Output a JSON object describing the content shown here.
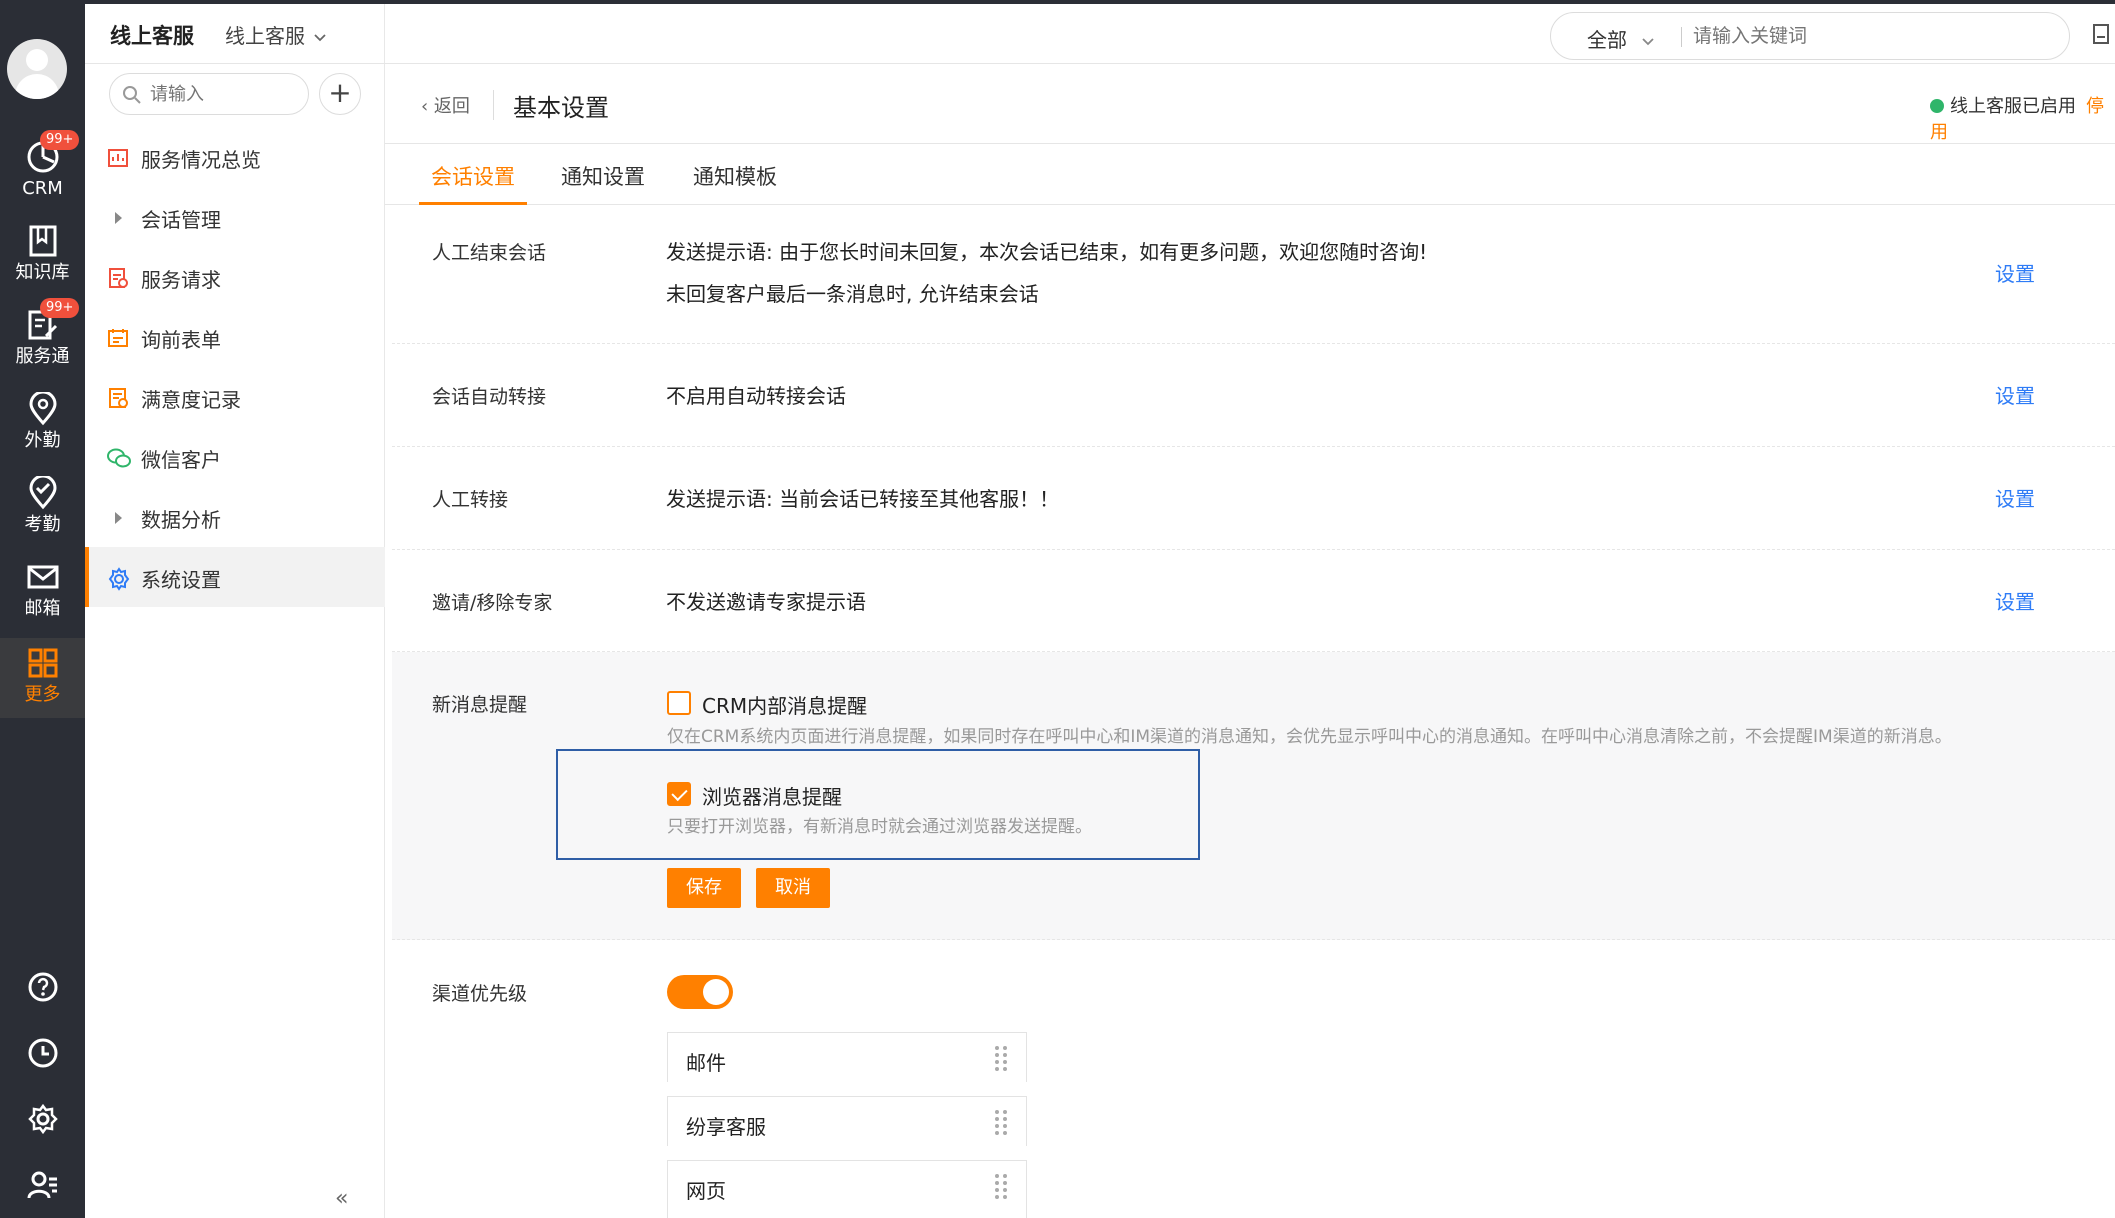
{
  "app": {
    "brand": "线上客服",
    "module_selector": "线上客服"
  },
  "rail": {
    "items": [
      {
        "label": "CRM",
        "badge": "99+",
        "icon": "crm-chart-icon"
      },
      {
        "label": "知识库",
        "badge": "",
        "icon": "book-icon"
      },
      {
        "label": "服务通",
        "badge": "99+",
        "icon": "service-edit-icon"
      },
      {
        "label": "外勤",
        "badge": "",
        "icon": "location-pin-icon"
      },
      {
        "label": "考勤",
        "badge": "",
        "icon": "check-circle-icon"
      },
      {
        "label": "邮箱",
        "badge": "",
        "icon": "mail-icon"
      },
      {
        "label": "更多",
        "badge": "",
        "icon": "grid-icon",
        "active": true
      }
    ],
    "bottom_icons": [
      "help-icon",
      "clock-icon",
      "settings-gear-icon",
      "user-list-icon"
    ],
    "active_color": "#ff8000"
  },
  "sidebar": {
    "search_placeholder": "请输入",
    "items": [
      {
        "label": "服务情况总览",
        "icon": "overview-icon"
      },
      {
        "label": "会话管理",
        "icon": "caret-right-icon"
      },
      {
        "label": "服务请求",
        "icon": "request-icon"
      },
      {
        "label": "询前表单",
        "icon": "form-icon"
      },
      {
        "label": "满意度记录",
        "icon": "satisfaction-icon"
      },
      {
        "label": "微信客户",
        "icon": "wechat-icon"
      },
      {
        "label": "数据分析",
        "icon": "caret-right-icon"
      },
      {
        "label": "系统设置",
        "icon": "gear-icon",
        "active": true
      }
    ],
    "collapse_glyph": "«"
  },
  "header": {
    "search_scope": "全部",
    "search_placeholder": "请输入关键词"
  },
  "page": {
    "back_label": "返回",
    "title": "基本设置",
    "status_text": "线上客服已启用",
    "disable_label": "停用"
  },
  "tabs": [
    {
      "label": "会话设置",
      "active": true
    },
    {
      "label": "通知设置",
      "active": false
    },
    {
      "label": "通知模板",
      "active": false
    }
  ],
  "settings": {
    "end_session": {
      "label": "人工结束会话",
      "line1": "发送提示语: 由于您长时间未回复，本次会话已结束，如有更多问题，欢迎您随时咨询!",
      "line2": "未回复客户最后一条消息时, 允许结束会话",
      "action": "设置"
    },
    "auto_transfer": {
      "label": "会话自动转接",
      "value": "不启用自动转接会话",
      "action": "设置"
    },
    "manual_transfer": {
      "label": "人工转接",
      "value": "发送提示语: 当前会话已转接至其他客服！！",
      "action": "设置"
    },
    "expert": {
      "label": "邀请/移除专家",
      "value": "不发送邀请专家提示语",
      "action": "设置"
    },
    "new_message": {
      "label": "新消息提醒",
      "crm_option": {
        "label": "CRM内部消息提醒",
        "checked": false,
        "desc": "仅在CRM系统内页面进行消息提醒，如果同时存在呼叫中心和IM渠道的消息通知，会优先显示呼叫中心的消息通知。在呼叫中心消息清除之前，不会提醒IM渠道的新消息。"
      },
      "browser_option": {
        "label": "浏览器消息提醒",
        "checked": true,
        "desc": "只要打开浏览器，有新消息时就会通过浏览器发送提醒。"
      },
      "save_label": "保存",
      "cancel_label": "取消"
    },
    "channel_priority": {
      "label": "渠道优先级",
      "enabled": true,
      "channels": [
        "邮件",
        "纷享客服",
        "网页"
      ]
    }
  },
  "colors": {
    "accent": "#ff8000",
    "link": "#2f7cf6",
    "rail_bg": "#2b2e36",
    "status_green": "#2fb56a"
  }
}
